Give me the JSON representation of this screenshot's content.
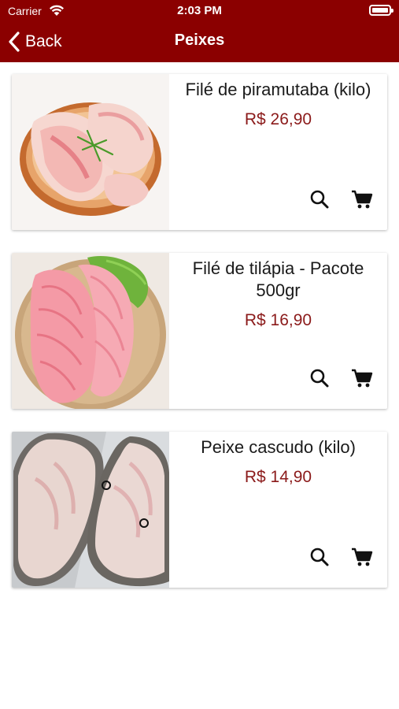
{
  "status_bar": {
    "carrier": "Carrier",
    "time": "2:03 PM"
  },
  "nav": {
    "back_label": "Back",
    "title": "Peixes"
  },
  "colors": {
    "brand": "#8b0000",
    "price": "#8b1a1a"
  },
  "products": [
    {
      "name": "Filé de piramutaba (kilo)",
      "price": "R$ 26,90",
      "image": "fish-fillet-on-plate"
    },
    {
      "name": "Filé de tilápia - Pacote 500gr",
      "price": "R$ 16,90",
      "image": "tilapia-fillet-with-lettuce"
    },
    {
      "name": "Peixe cascudo (kilo)",
      "price": "R$ 14,90",
      "image": "cascudo-fish-steaks"
    }
  ]
}
